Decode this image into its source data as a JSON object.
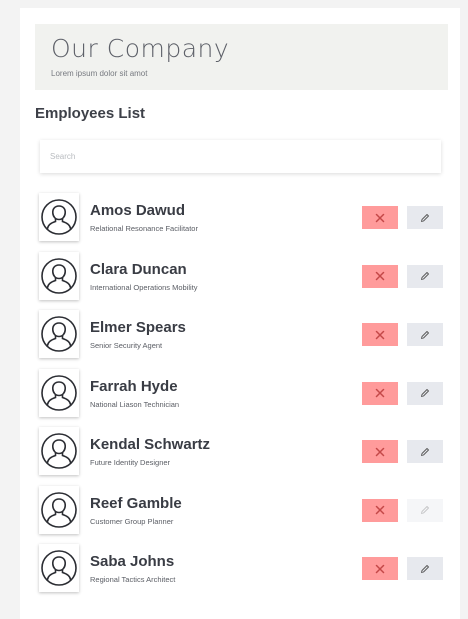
{
  "header": {
    "title": "Our Company",
    "subtitle": "Lorem ipsum dolor sit amot"
  },
  "list_title": "Employees List",
  "search": {
    "placeholder": "Search",
    "value": ""
  },
  "employees": [
    {
      "name": "Amos Dawud",
      "role": "Relational Resonance Facilitator",
      "edit_enabled": true
    },
    {
      "name": "Clara Duncan",
      "role": "International Operations Mobility",
      "edit_enabled": true
    },
    {
      "name": "Elmer Spears",
      "role": "Senior Security Agent",
      "edit_enabled": true
    },
    {
      "name": "Farrah Hyde",
      "role": "National Liason Technician",
      "edit_enabled": true
    },
    {
      "name": "Kendal Schwartz",
      "role": "Future Identity Designer",
      "edit_enabled": true
    },
    {
      "name": "Reef Gamble",
      "role": "Customer Group Planner",
      "edit_enabled": false
    },
    {
      "name": "Saba Johns",
      "role": "Regional Tactics Architect",
      "edit_enabled": true
    }
  ],
  "icons": {
    "avatar": "user-circle-icon",
    "delete": "close-icon",
    "edit": "pencil-icon"
  },
  "colors": {
    "delete_button": "#ff9b9b",
    "edit_button": "#e7e9ee",
    "header_bg": "#f1f2ef"
  }
}
